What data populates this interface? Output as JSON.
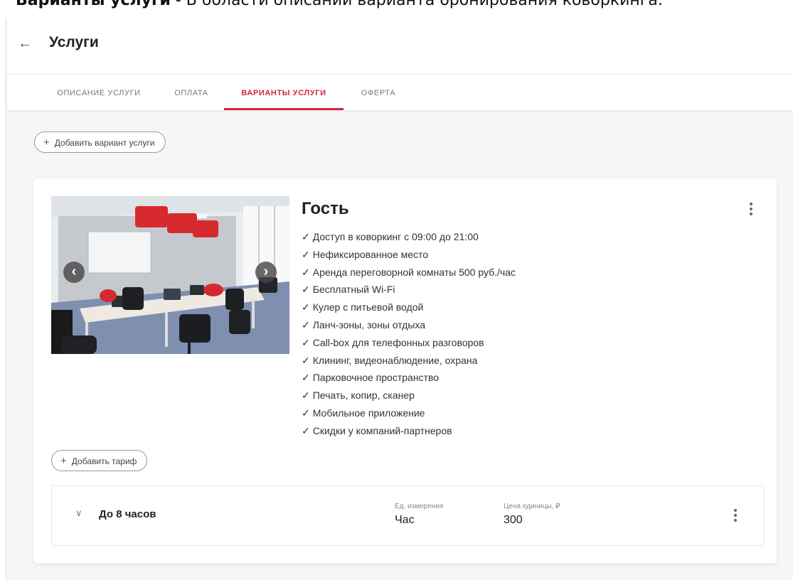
{
  "caption": {
    "bold": "Варианты услуги",
    "rest": " - В области описании варианта бронирования коворкинга."
  },
  "header": {
    "title": "Услуги"
  },
  "tabs": [
    {
      "label": "ОПИСАНИЕ УСЛУГИ",
      "active": false
    },
    {
      "label": "ОПЛАТА",
      "active": false
    },
    {
      "label": "ВАРИАНТЫ УСЛУГИ",
      "active": true
    },
    {
      "label": "ОФЕРТА",
      "active": false
    }
  ],
  "actions": {
    "add_variant": "Добавить вариант услуги",
    "add_tariff": "Добавить тариф"
  },
  "variant": {
    "name": "Гость",
    "features": [
      "Доступ в коворкинг с 09:00 до 21:00",
      "Нефиксированное место",
      "Аренда переговорной комнаты 500 руб./час",
      "Бесплатный Wi-Fi",
      "Кулер с питьевой водой",
      "Ланч-зоны, зоны отдыха",
      "Call-box для телефонных разговоров",
      "Клининг, видеонаблюдение, охрана",
      "Парковочное пространство",
      "Печать, копир, сканер",
      "Мобильное приложение",
      "Скидки у компаний-партнеров"
    ]
  },
  "tariff": {
    "name": "До 8 часов",
    "unit_label": "Ед. измерения",
    "unit_value": "Час",
    "price_label": "Цена единицы, ₽",
    "price_value": "300"
  },
  "icons": {
    "back": "arrow-left-icon",
    "plus": "plus-icon",
    "more": "more-vertical-icon",
    "expand": "chevron-down-icon",
    "prev": "chevron-left-icon",
    "next": "chevron-right-icon",
    "check": "check-icon"
  },
  "colors": {
    "accent": "#d3243a",
    "background": "#f6f6f6"
  }
}
